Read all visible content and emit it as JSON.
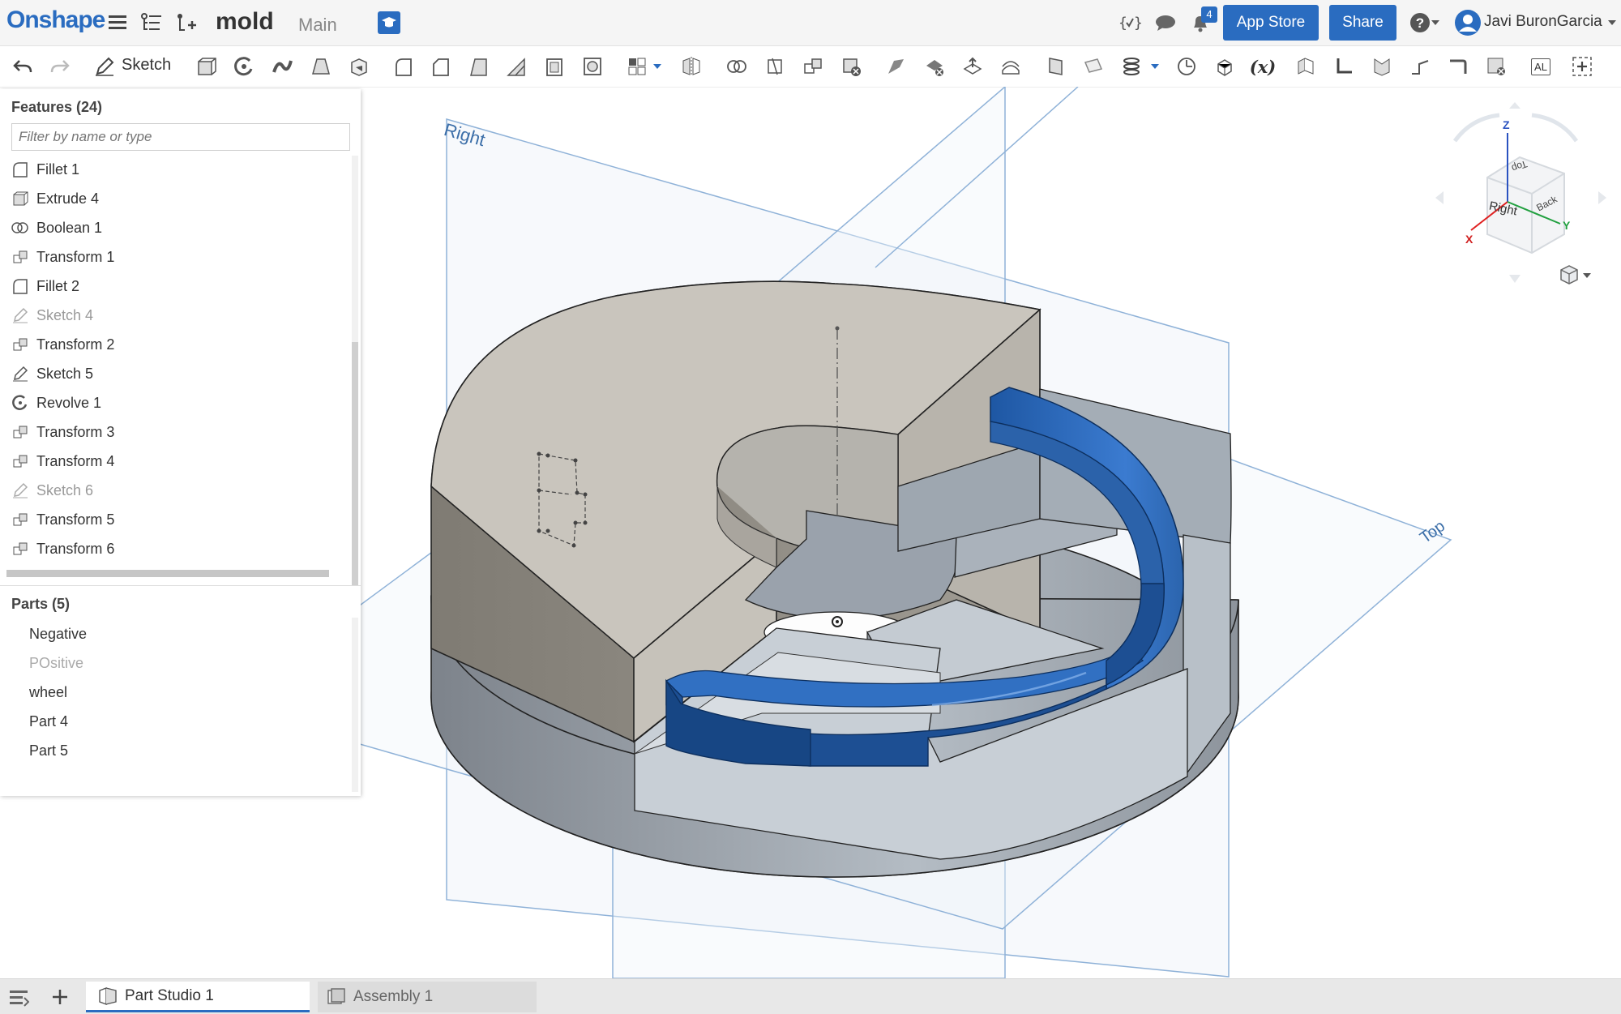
{
  "app": {
    "logo": "Onshape",
    "document_name": "mold",
    "workspace": "Main",
    "notification_count": "4"
  },
  "header": {
    "app_store_label": "App Store",
    "share_label": "Share",
    "user_name": "Javi BuronGarcia"
  },
  "toolbar": {
    "sketch_label": "Sketch",
    "variable_label": "(x)",
    "al_label": "AL"
  },
  "features": {
    "title": "Features (24)",
    "filter_placeholder": "Filter by name or type",
    "items": [
      {
        "label": "Fillet 1",
        "icon": "fillet-icon"
      },
      {
        "label": "Extrude 4",
        "icon": "extrude-icon"
      },
      {
        "label": "Boolean 1",
        "icon": "boolean-icon"
      },
      {
        "label": "Transform 1",
        "icon": "transform-icon"
      },
      {
        "label": "Fillet 2",
        "icon": "fillet-icon"
      },
      {
        "label": "Sketch 4",
        "icon": "sketch-icon"
      },
      {
        "label": "Transform 2",
        "icon": "transform-icon"
      },
      {
        "label": "Sketch 5",
        "icon": "sketch-icon"
      },
      {
        "label": "Revolve 1",
        "icon": "revolve-icon"
      },
      {
        "label": "Transform 3",
        "icon": "transform-icon"
      },
      {
        "label": "Transform 4",
        "icon": "transform-icon"
      },
      {
        "label": "Sketch 6",
        "icon": "sketch-icon"
      },
      {
        "label": "Transform 5",
        "icon": "transform-icon"
      },
      {
        "label": "Transform 6",
        "icon": "transform-icon"
      }
    ]
  },
  "parts": {
    "title": "Parts (5)",
    "items": [
      {
        "label": "Negative"
      },
      {
        "label": "POsitive"
      },
      {
        "label": "wheel"
      },
      {
        "label": "Part 4"
      },
      {
        "label": "Part 5"
      }
    ]
  },
  "viewport": {
    "plane_right": "Right",
    "plane_top": "Top"
  },
  "view_cube": {
    "axis_z": "Z",
    "axis_x": "X",
    "axis_y": "Y",
    "face_right": "Right",
    "face_top": "Top",
    "face_back": "Back"
  },
  "tabs": [
    {
      "label": "Part Studio 1"
    },
    {
      "label": "Assembly 1"
    }
  ],
  "colors": {
    "accent": "#2a6cc0",
    "part_blue": "#2b64ad",
    "plane": "#8fb2d8"
  }
}
